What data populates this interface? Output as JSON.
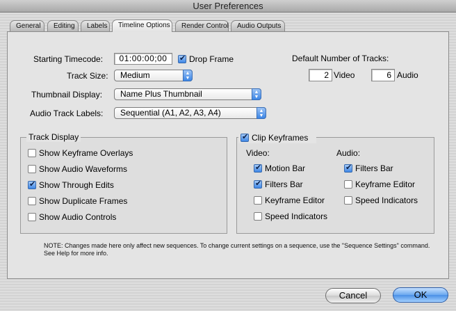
{
  "window": {
    "title": "User Preferences"
  },
  "tabs": [
    {
      "label": "General",
      "active": false
    },
    {
      "label": "Editing",
      "active": false
    },
    {
      "label": "Labels",
      "active": false
    },
    {
      "label": "Timeline Options",
      "active": true
    },
    {
      "label": "Render Control",
      "active": false
    },
    {
      "label": "Audio Outputs",
      "active": false
    }
  ],
  "timeline": {
    "starting_timecode_label": "Starting Timecode:",
    "starting_timecode_value": "01:00:00;00",
    "drop_frame_label": "Drop Frame",
    "drop_frame_checked": true,
    "track_size_label": "Track Size:",
    "track_size_value": "Medium",
    "thumbnail_label": "Thumbnail Display:",
    "thumbnail_value": "Name Plus Thumbnail",
    "audio_labels_label": "Audio Track Labels:",
    "audio_labels_value": "Sequential (A1, A2, A3, A4)",
    "default_tracks_label": "Default Number of Tracks:",
    "video_tracks_value": "2",
    "video_label": "Video",
    "audio_tracks_value": "6",
    "audio_label": "Audio"
  },
  "track_display": {
    "title": "Track Display",
    "items": [
      {
        "label": "Show Keyframe Overlays",
        "checked": false
      },
      {
        "label": "Show Audio Waveforms",
        "checked": false
      },
      {
        "label": "Show Through Edits",
        "checked": true
      },
      {
        "label": "Show Duplicate Frames",
        "checked": false
      },
      {
        "label": "Show Audio Controls",
        "checked": false
      }
    ]
  },
  "clip_keyframes": {
    "title": "Clip Keyframes",
    "checked": true,
    "video_heading": "Video:",
    "audio_heading": "Audio:",
    "video_items": [
      {
        "label": "Motion Bar",
        "checked": true
      },
      {
        "label": "Filters Bar",
        "checked": true
      },
      {
        "label": "Keyframe Editor",
        "checked": false
      },
      {
        "label": "Speed Indicators",
        "checked": false
      }
    ],
    "audio_items": [
      {
        "label": "Filters Bar",
        "checked": true
      },
      {
        "label": "Keyframe Editor",
        "checked": false
      },
      {
        "label": "Speed Indicators",
        "checked": false
      }
    ]
  },
  "note": "NOTE: Changes made here only affect new sequences. To change current settings on a sequence, use the \"Sequence Settings\" command. See Help for more info.",
  "buttons": {
    "cancel": "Cancel",
    "ok": "OK"
  }
}
